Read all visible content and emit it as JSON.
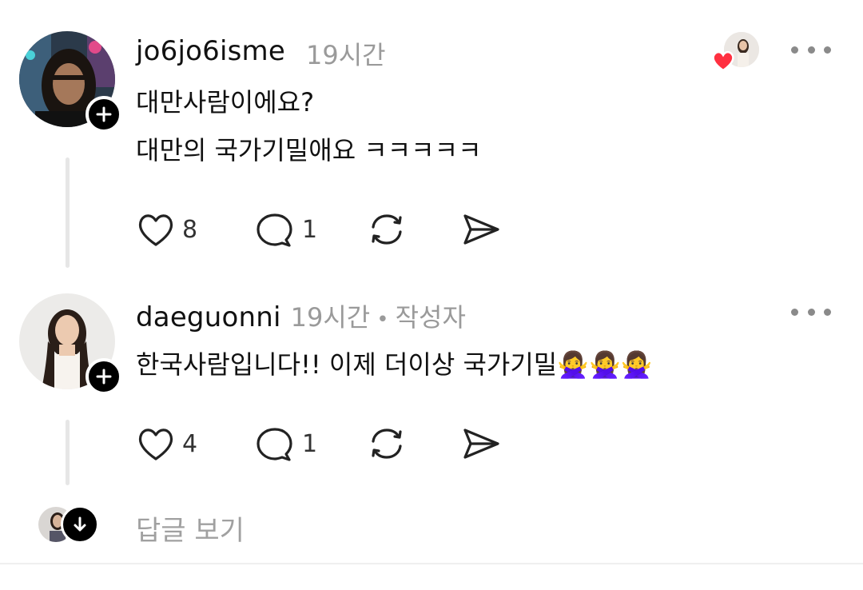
{
  "comments": [
    {
      "username": "jo6jo6isme",
      "time": "19시간",
      "lines": [
        "대만사람이에요?",
        "대만의 국가기밀애요 ㅋㅋㅋㅋㅋ"
      ],
      "likes": "8",
      "replies": "1",
      "liked_by_author": true
    },
    {
      "username": "daeguonni",
      "time": "19시간",
      "separator": "•",
      "author_badge": "작성자",
      "text": "한국사람입니다!! 이제 더이상 국가기밀🙅‍♀️🙅‍♀️🙅‍♀️",
      "likes": "4",
      "replies": "1"
    }
  ],
  "view_replies_label": "답글 보기",
  "icons": {
    "like": "heart-icon",
    "reply": "comment-icon",
    "repost": "repost-icon",
    "share": "send-icon",
    "more": "more-icon",
    "follow": "plus-icon",
    "expand": "arrow-down-icon"
  },
  "colors": {
    "heart": "#ff3040",
    "text": "#111111",
    "muted": "#9a9a9a"
  }
}
